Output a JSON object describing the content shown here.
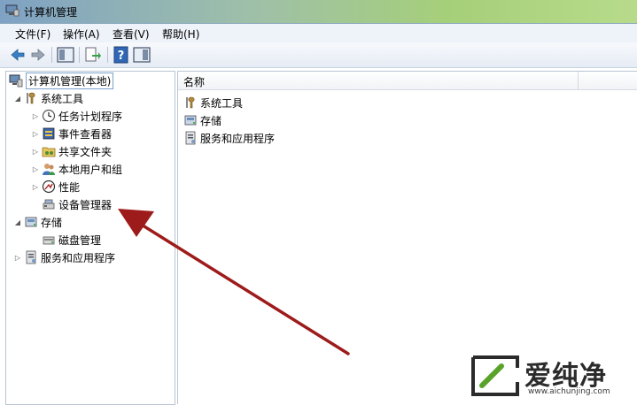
{
  "window": {
    "title": "计算机管理"
  },
  "menu": [
    "文件(F)",
    "操作(A)",
    "查看(V)",
    "帮助(H)"
  ],
  "toolbar": [
    "back-icon",
    "forward-icon",
    "show-hide-tree-icon",
    "export-list-icon",
    "help-icon",
    "action-pane-icon"
  ],
  "tree": {
    "root": "计算机管理(本地)",
    "system_tools": "系统工具",
    "task_scheduler": "任务计划程序",
    "event_viewer": "事件查看器",
    "shared_folders": "共享文件夹",
    "local_users": "本地用户和组",
    "performance": "性能",
    "device_manager": "设备管理器",
    "storage": "存储",
    "disk_management": "磁盘管理",
    "services_apps": "服务和应用程序"
  },
  "list": {
    "column_name": "名称",
    "items": [
      "系统工具",
      "存储",
      "服务和应用程序"
    ]
  },
  "watermark": {
    "brand": "爱纯净",
    "url": "www.aichunjing.com"
  },
  "colors": {
    "arrow": "#9e1b1b",
    "accent": "#7fa2c4"
  }
}
